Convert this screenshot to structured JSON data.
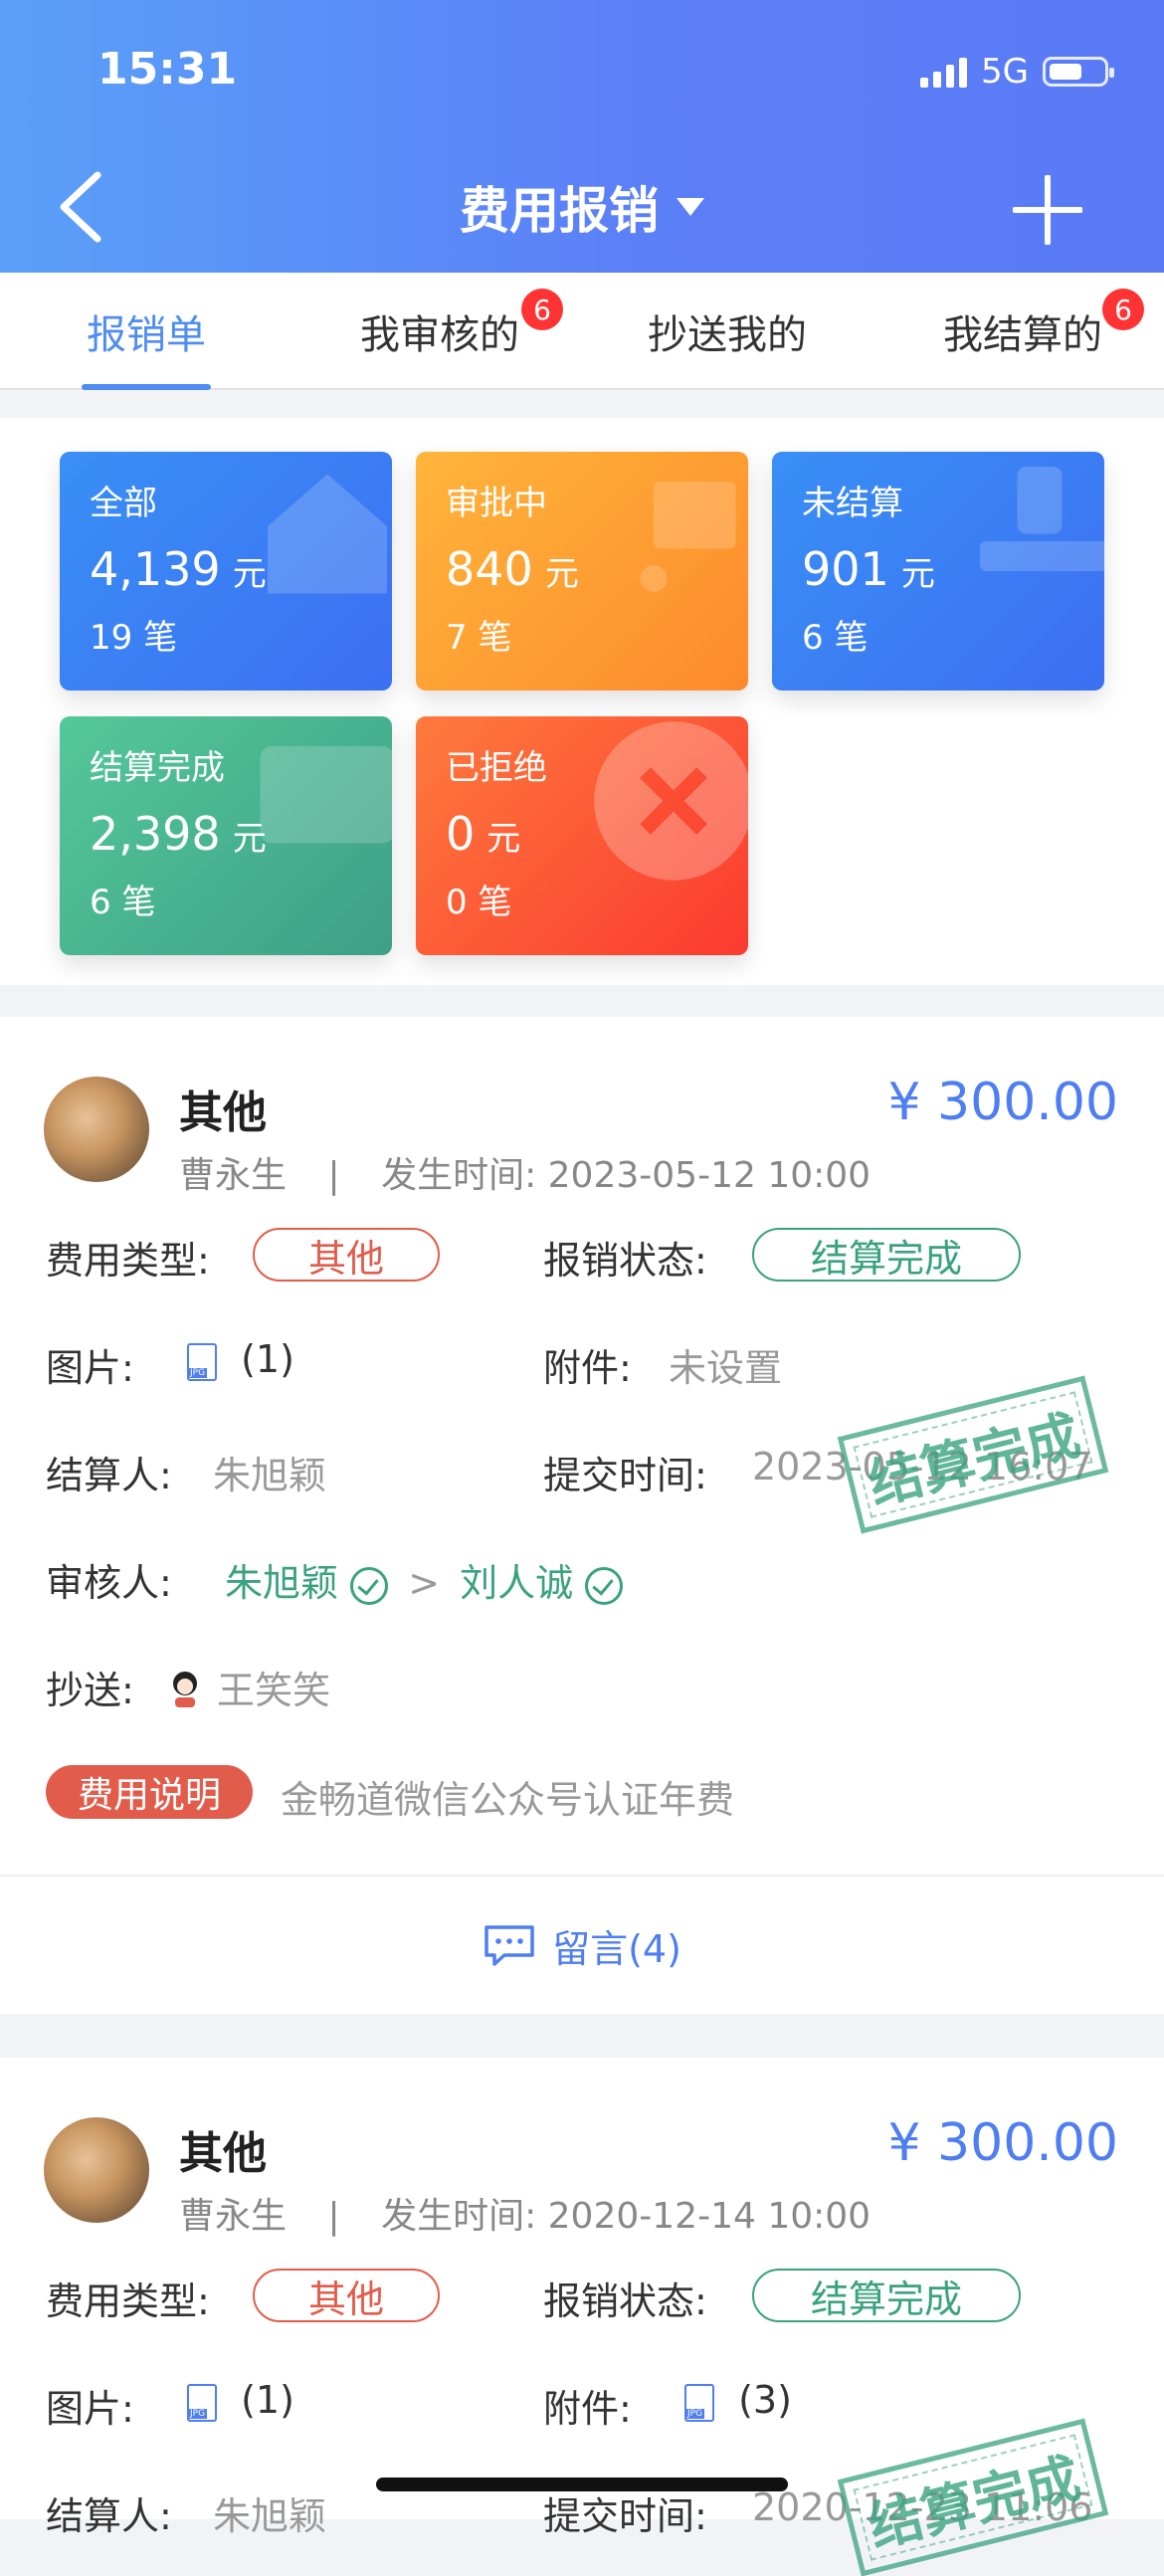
{
  "status": {
    "time": "15:31",
    "network": "5G"
  },
  "header": {
    "title": "费用报销"
  },
  "tabs": [
    {
      "label": "报销单"
    },
    {
      "label": "我审核的",
      "badge": "6"
    },
    {
      "label": "抄送我的"
    },
    {
      "label": "我结算的",
      "badge": "6"
    }
  ],
  "summary": [
    {
      "title": "全部",
      "amount": "4,139",
      "unit": "元",
      "count": "19 笔",
      "color": "#3c7ef4"
    },
    {
      "title": "审批中",
      "amount": "840",
      "unit": "元",
      "count": "7 笔",
      "color": "#fe9a33"
    },
    {
      "title": "未结算",
      "amount": "901",
      "unit": "元",
      "count": "6 笔",
      "color": "#3a86f5"
    },
    {
      "title": "结算完成",
      "amount": "2,398",
      "unit": "元",
      "count": "6 笔",
      "color": "#46b38e"
    },
    {
      "title": "已拒绝",
      "amount": "0",
      "unit": "元",
      "count": "0 笔",
      "color": "#fc5b34"
    }
  ],
  "labels": {
    "expense_type": "费用类型:",
    "status": "报销状态:",
    "images": "图片:",
    "attachments": "附件:",
    "settler": "结算人:",
    "submit_time": "提交时间:",
    "reviewer": "审核人:",
    "cc": "抄送:",
    "desc": "费用说明",
    "separator": "|",
    "occur_prefix": "发生时间:",
    "arrow": ">",
    "comment": "留言(4)"
  },
  "entries": [
    {
      "name": "其他",
      "person": "曹永生",
      "occur_time": "2023-05-12 10:00",
      "amount": "¥ 300.00",
      "type": "其他",
      "status": "结算完成",
      "images": "(1)",
      "attachments": "未设置",
      "settler": "朱旭颖",
      "submit_time": "2023-05-12 16:07",
      "reviewer1": "朱旭颖",
      "reviewer2": "刘人诚",
      "cc": "王笑笑",
      "desc": "金畅道微信公众号认证年费",
      "stamp": "结算完成"
    },
    {
      "name": "其他",
      "person": "曹永生",
      "occur_time": "2020-12-14 10:00",
      "amount": "¥ 300.00",
      "type": "其他",
      "status": "结算完成",
      "images": "(1)",
      "attachments": "(3)",
      "settler": "朱旭颖",
      "submit_time": "2020-12-23 11:06",
      "stamp": "结算完成"
    }
  ]
}
